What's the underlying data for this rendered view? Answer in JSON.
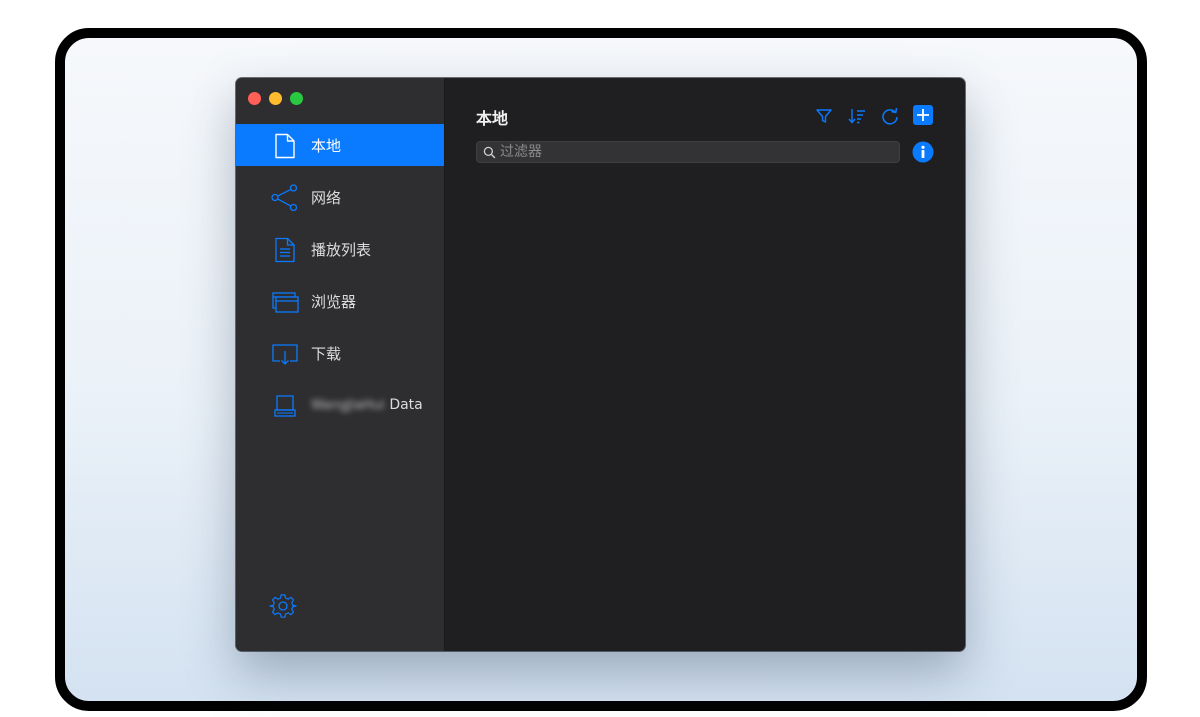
{
  "window": {
    "title": "本地",
    "traffic_lights": [
      "close",
      "minimize",
      "zoom"
    ]
  },
  "sidebar": {
    "items": [
      {
        "label": "本地",
        "icon": "document-icon",
        "active": true
      },
      {
        "label": "网络",
        "icon": "share-icon",
        "active": false
      },
      {
        "label": "播放列表",
        "icon": "playlist-icon",
        "active": false
      },
      {
        "label": "浏览器",
        "icon": "browser-window-icon",
        "active": false
      },
      {
        "label": "下载",
        "icon": "download-icon",
        "active": false
      },
      {
        "label_blurred": "WangJiaHui",
        "label": "Data",
        "icon": "drive-icon",
        "active": false
      }
    ],
    "settings_icon": "gear-icon"
  },
  "toolbar": {
    "filter_icon": "filter-icon",
    "sort_icon": "sort-icon",
    "refresh_icon": "refresh-icon",
    "add_icon": "plus-icon"
  },
  "search": {
    "placeholder": "过滤器",
    "value": ""
  },
  "colors": {
    "accent": "#0a7aff",
    "sidebar_bg": "#2e2e30",
    "main_bg": "#1f1f21"
  }
}
